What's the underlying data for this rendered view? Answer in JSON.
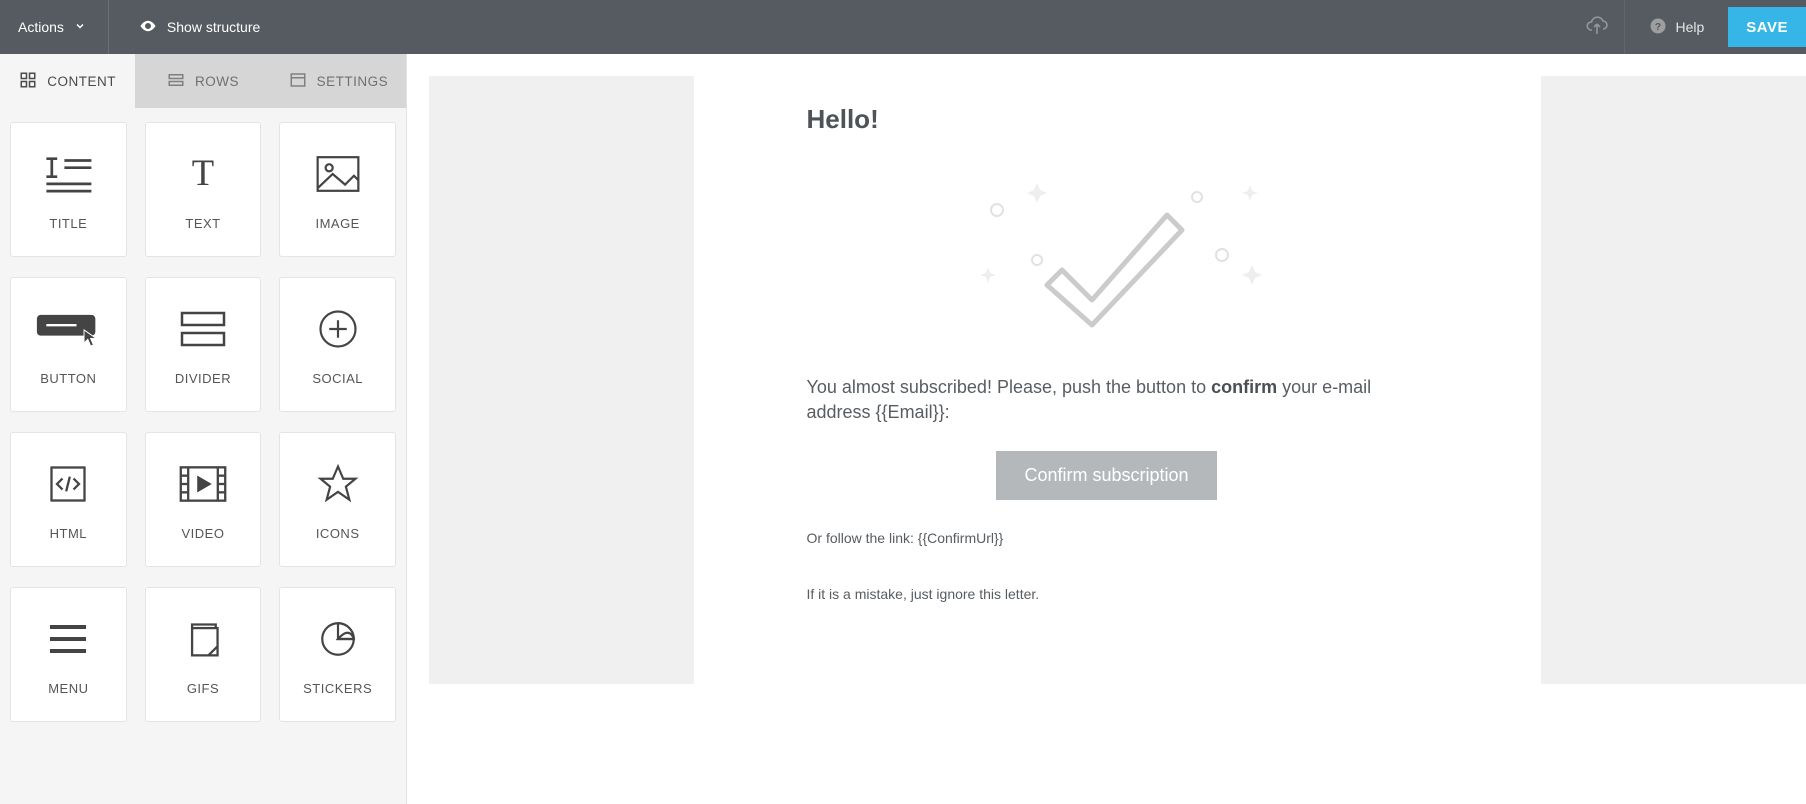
{
  "topbar": {
    "actions": "Actions",
    "show_structure": "Show structure",
    "help": "Help",
    "save": "SAVE"
  },
  "tabs": {
    "content": "CONTENT",
    "rows": "ROWS",
    "settings": "SETTINGS"
  },
  "blocks": {
    "title": "TITLE",
    "text": "TEXT",
    "image": "IMAGE",
    "button": "BUTTON",
    "divider": "DIVIDER",
    "social": "SOCIAL",
    "html": "HTML",
    "video": "VIDEO",
    "icons": "ICONS",
    "menu": "MENU",
    "gifs": "GIFS",
    "stickers": "STICKERS"
  },
  "email": {
    "heading": "Hello!",
    "para_a": "You almost subscribed! Please, push the button to ",
    "para_bold": "confirm",
    "para_b": " your e-mail address {{Email}}:",
    "button": "Confirm subscription",
    "follow": "Or follow the link: {{ConfirmUrl}}",
    "mistake": "If it is a mistake, just ignore this letter."
  }
}
